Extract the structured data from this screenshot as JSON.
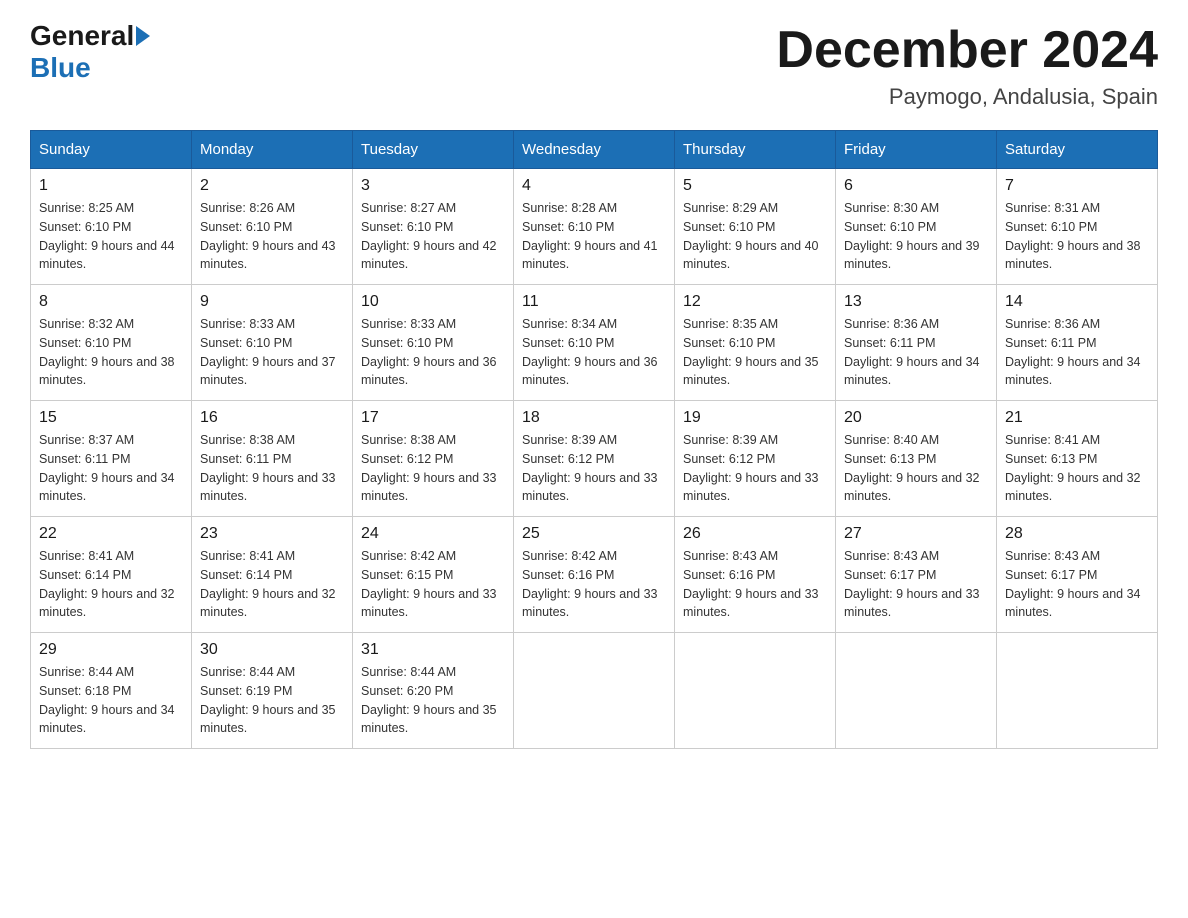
{
  "header": {
    "logo_general": "General",
    "logo_blue": "Blue",
    "month_title": "December 2024",
    "location": "Paymogo, Andalusia, Spain"
  },
  "weekdays": [
    "Sunday",
    "Monday",
    "Tuesday",
    "Wednesday",
    "Thursday",
    "Friday",
    "Saturday"
  ],
  "weeks": [
    [
      {
        "day": "1",
        "sunrise": "Sunrise: 8:25 AM",
        "sunset": "Sunset: 6:10 PM",
        "daylight": "Daylight: 9 hours and 44 minutes."
      },
      {
        "day": "2",
        "sunrise": "Sunrise: 8:26 AM",
        "sunset": "Sunset: 6:10 PM",
        "daylight": "Daylight: 9 hours and 43 minutes."
      },
      {
        "day": "3",
        "sunrise": "Sunrise: 8:27 AM",
        "sunset": "Sunset: 6:10 PM",
        "daylight": "Daylight: 9 hours and 42 minutes."
      },
      {
        "day": "4",
        "sunrise": "Sunrise: 8:28 AM",
        "sunset": "Sunset: 6:10 PM",
        "daylight": "Daylight: 9 hours and 41 minutes."
      },
      {
        "day": "5",
        "sunrise": "Sunrise: 8:29 AM",
        "sunset": "Sunset: 6:10 PM",
        "daylight": "Daylight: 9 hours and 40 minutes."
      },
      {
        "day": "6",
        "sunrise": "Sunrise: 8:30 AM",
        "sunset": "Sunset: 6:10 PM",
        "daylight": "Daylight: 9 hours and 39 minutes."
      },
      {
        "day": "7",
        "sunrise": "Sunrise: 8:31 AM",
        "sunset": "Sunset: 6:10 PM",
        "daylight": "Daylight: 9 hours and 38 minutes."
      }
    ],
    [
      {
        "day": "8",
        "sunrise": "Sunrise: 8:32 AM",
        "sunset": "Sunset: 6:10 PM",
        "daylight": "Daylight: 9 hours and 38 minutes."
      },
      {
        "day": "9",
        "sunrise": "Sunrise: 8:33 AM",
        "sunset": "Sunset: 6:10 PM",
        "daylight": "Daylight: 9 hours and 37 minutes."
      },
      {
        "day": "10",
        "sunrise": "Sunrise: 8:33 AM",
        "sunset": "Sunset: 6:10 PM",
        "daylight": "Daylight: 9 hours and 36 minutes."
      },
      {
        "day": "11",
        "sunrise": "Sunrise: 8:34 AM",
        "sunset": "Sunset: 6:10 PM",
        "daylight": "Daylight: 9 hours and 36 minutes."
      },
      {
        "day": "12",
        "sunrise": "Sunrise: 8:35 AM",
        "sunset": "Sunset: 6:10 PM",
        "daylight": "Daylight: 9 hours and 35 minutes."
      },
      {
        "day": "13",
        "sunrise": "Sunrise: 8:36 AM",
        "sunset": "Sunset: 6:11 PM",
        "daylight": "Daylight: 9 hours and 34 minutes."
      },
      {
        "day": "14",
        "sunrise": "Sunrise: 8:36 AM",
        "sunset": "Sunset: 6:11 PM",
        "daylight": "Daylight: 9 hours and 34 minutes."
      }
    ],
    [
      {
        "day": "15",
        "sunrise": "Sunrise: 8:37 AM",
        "sunset": "Sunset: 6:11 PM",
        "daylight": "Daylight: 9 hours and 34 minutes."
      },
      {
        "day": "16",
        "sunrise": "Sunrise: 8:38 AM",
        "sunset": "Sunset: 6:11 PM",
        "daylight": "Daylight: 9 hours and 33 minutes."
      },
      {
        "day": "17",
        "sunrise": "Sunrise: 8:38 AM",
        "sunset": "Sunset: 6:12 PM",
        "daylight": "Daylight: 9 hours and 33 minutes."
      },
      {
        "day": "18",
        "sunrise": "Sunrise: 8:39 AM",
        "sunset": "Sunset: 6:12 PM",
        "daylight": "Daylight: 9 hours and 33 minutes."
      },
      {
        "day": "19",
        "sunrise": "Sunrise: 8:39 AM",
        "sunset": "Sunset: 6:12 PM",
        "daylight": "Daylight: 9 hours and 33 minutes."
      },
      {
        "day": "20",
        "sunrise": "Sunrise: 8:40 AM",
        "sunset": "Sunset: 6:13 PM",
        "daylight": "Daylight: 9 hours and 32 minutes."
      },
      {
        "day": "21",
        "sunrise": "Sunrise: 8:41 AM",
        "sunset": "Sunset: 6:13 PM",
        "daylight": "Daylight: 9 hours and 32 minutes."
      }
    ],
    [
      {
        "day": "22",
        "sunrise": "Sunrise: 8:41 AM",
        "sunset": "Sunset: 6:14 PM",
        "daylight": "Daylight: 9 hours and 32 minutes."
      },
      {
        "day": "23",
        "sunrise": "Sunrise: 8:41 AM",
        "sunset": "Sunset: 6:14 PM",
        "daylight": "Daylight: 9 hours and 32 minutes."
      },
      {
        "day": "24",
        "sunrise": "Sunrise: 8:42 AM",
        "sunset": "Sunset: 6:15 PM",
        "daylight": "Daylight: 9 hours and 33 minutes."
      },
      {
        "day": "25",
        "sunrise": "Sunrise: 8:42 AM",
        "sunset": "Sunset: 6:16 PM",
        "daylight": "Daylight: 9 hours and 33 minutes."
      },
      {
        "day": "26",
        "sunrise": "Sunrise: 8:43 AM",
        "sunset": "Sunset: 6:16 PM",
        "daylight": "Daylight: 9 hours and 33 minutes."
      },
      {
        "day": "27",
        "sunrise": "Sunrise: 8:43 AM",
        "sunset": "Sunset: 6:17 PM",
        "daylight": "Daylight: 9 hours and 33 minutes."
      },
      {
        "day": "28",
        "sunrise": "Sunrise: 8:43 AM",
        "sunset": "Sunset: 6:17 PM",
        "daylight": "Daylight: 9 hours and 34 minutes."
      }
    ],
    [
      {
        "day": "29",
        "sunrise": "Sunrise: 8:44 AM",
        "sunset": "Sunset: 6:18 PM",
        "daylight": "Daylight: 9 hours and 34 minutes."
      },
      {
        "day": "30",
        "sunrise": "Sunrise: 8:44 AM",
        "sunset": "Sunset: 6:19 PM",
        "daylight": "Daylight: 9 hours and 35 minutes."
      },
      {
        "day": "31",
        "sunrise": "Sunrise: 8:44 AM",
        "sunset": "Sunset: 6:20 PM",
        "daylight": "Daylight: 9 hours and 35 minutes."
      },
      null,
      null,
      null,
      null
    ]
  ]
}
